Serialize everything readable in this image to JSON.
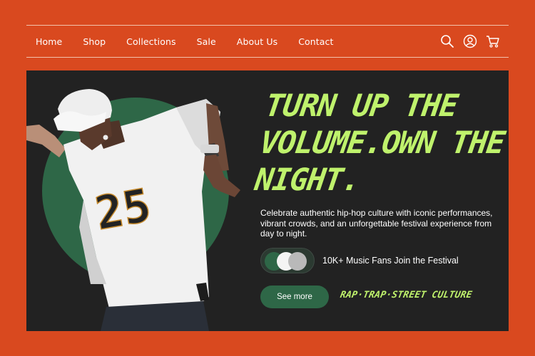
{
  "nav": {
    "links": [
      "Home",
      "Shop",
      "Collections",
      "Sale",
      "About Us",
      "Contact"
    ],
    "icons": [
      "search-icon",
      "user-icon",
      "cart-icon"
    ]
  },
  "hero": {
    "headline": "TURN UP THE VOLUME.OWN THE NIGHT.",
    "description": "Celebrate authentic hip-hop culture with iconic performances, vibrant crowds, and an unforgettable festival experience from day to night.",
    "fans_text": "10K+ Music Fans Join the Festival",
    "cta_label": "See more",
    "tagline": "RAP·TRAP·STREET CULTURE",
    "jersey_number": "25"
  },
  "colors": {
    "background": "#d9491f",
    "panel": "#222222",
    "accent_green": "#2e6747",
    "lime": "#bff26c"
  }
}
